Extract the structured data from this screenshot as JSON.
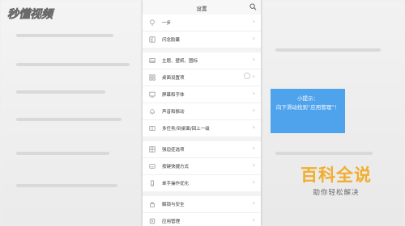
{
  "logo": {
    "text": "秒懂视频"
  },
  "screen": {
    "title": "设置",
    "groups": [
      [
        {
          "icon": "pin-icon",
          "label": "一步"
        },
        {
          "icon": "flash-icon",
          "label": "闪念胶囊"
        }
      ],
      [
        {
          "icon": "image-icon",
          "label": "主题、壁纸、图标"
        },
        {
          "icon": "grid-icon",
          "label": "桌面设置项"
        },
        {
          "icon": "display-icon",
          "label": "屏幕和字体"
        },
        {
          "icon": "bell-icon",
          "label": "声音和振动"
        },
        {
          "icon": "book-icon",
          "label": "多任务/到桌面/回上一级"
        }
      ],
      [
        {
          "icon": "apps-icon",
          "label": "强迫症选项"
        },
        {
          "icon": "keyboard-icon",
          "label": "按键快捷方式"
        },
        {
          "icon": "hand-icon",
          "label": "单手操作优化"
        }
      ],
      [
        {
          "icon": "lock-icon",
          "label": "解锁与安全"
        },
        {
          "icon": "app-manage-icon",
          "label": "应用管理"
        }
      ]
    ]
  },
  "tip": {
    "title": "小提示：",
    "body": "向下滑动找到“应用管理”！"
  },
  "watermark": {
    "title": "百科全说",
    "subtitle": "助你轻松解决"
  },
  "colors": {
    "tip_bg": "#4fa2ec",
    "watermark_title": "#f1ad2d",
    "watermark_sub": "#686868"
  }
}
